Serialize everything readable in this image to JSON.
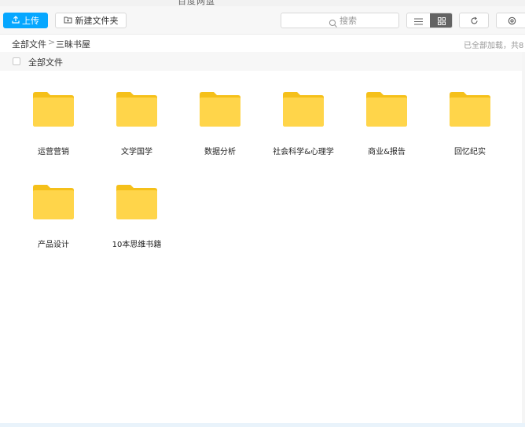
{
  "window": {
    "title": "百度网盘"
  },
  "toolbar": {
    "upload_label": "上传",
    "new_folder_label": "新建文件夹",
    "search": {
      "placeholder": "搜索",
      "value": ""
    }
  },
  "breadcrumb": {
    "root": "全部文件",
    "separator": ">",
    "current": "三昧书屋",
    "status": "已全部加载，共8"
  },
  "select_all": {
    "label": "全部文件"
  },
  "folders": [
    {
      "name": "运营营销"
    },
    {
      "name": "文学国学"
    },
    {
      "name": "数据分析"
    },
    {
      "name": "社会科学&心理学"
    },
    {
      "name": "商业&报告"
    },
    {
      "name": "回忆纪实"
    },
    {
      "name": "产品设计"
    },
    {
      "name": "10本思维书籍"
    }
  ],
  "colors": {
    "accent": "#06a7ff",
    "folder": "#ffd54a",
    "folder_tab": "#f5c01a"
  },
  "icons": {
    "upload": "upload-icon",
    "new_folder": "new-folder-icon",
    "search": "search-icon",
    "list_view": "list-view-icon",
    "grid_view": "grid-view-icon",
    "refresh": "refresh-icon",
    "settings": "settings-icon",
    "folder": "folder-icon"
  }
}
